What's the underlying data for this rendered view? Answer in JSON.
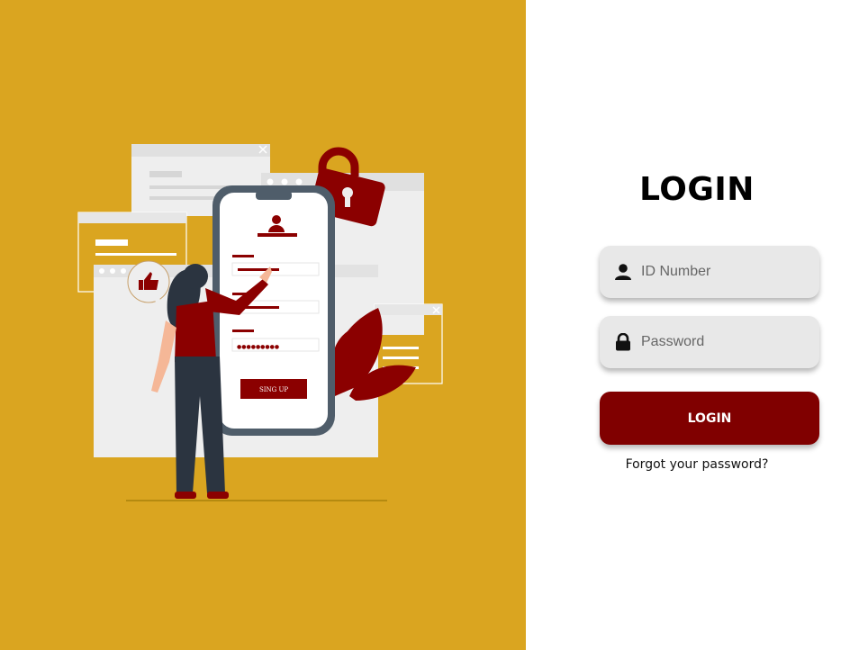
{
  "colors": {
    "left_panel_bg": "#DAA520",
    "accent": "#800000",
    "field_bg": "#e8e8e8"
  },
  "illustration": {
    "phone_button_label": "SING UP",
    "password_dots": "●●●●●●●●●",
    "icons": [
      "user-icon",
      "lock-icon",
      "thumbs-up-icon",
      "close-icon"
    ]
  },
  "login": {
    "title": "LOGIN",
    "id_field": {
      "placeholder": "ID Number",
      "value": "",
      "icon": "user-icon"
    },
    "password_field": {
      "placeholder": "Password",
      "value": "",
      "icon": "lock-icon"
    },
    "button_label": "LOGIN",
    "forgot_link": "Forgot your password?"
  }
}
